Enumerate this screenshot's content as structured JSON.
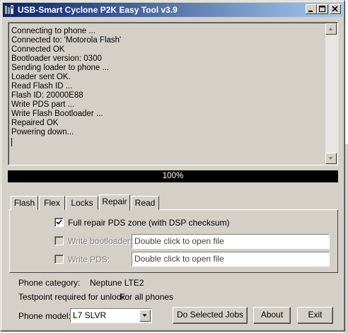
{
  "window": {
    "title": "USB-Smart Cyclone  P2K Easy Tool v3.9",
    "controls": [
      "minimize",
      "maximize",
      "close"
    ]
  },
  "log": {
    "lines": [
      "Connecting to phone ...",
      "Connected to: 'Motorola Flash'",
      "Connected OK",
      "Bootloader version: 0300",
      "Sending loader to phone ...",
      "Loader sent OK.",
      "Read Flash ID ...",
      "Flash ID: 20000E88",
      "Write PDS part ...",
      "Write Flash Bootloader ...",
      "Repaired OK",
      "Powering down..."
    ]
  },
  "progress": {
    "value": 1.0,
    "label": "100%"
  },
  "tabs": [
    {
      "label": "Flash",
      "active": false
    },
    {
      "label": "Flex",
      "active": false
    },
    {
      "label": "Locks",
      "active": false
    },
    {
      "label": "Repair",
      "active": true
    },
    {
      "label": "Read",
      "active": false
    }
  ],
  "repair": {
    "full_repair_label": "Full repair PDS zone (with DSP checksum)",
    "full_repair_checked": true,
    "write_bootloader_label": "Write bootloader:",
    "write_bootloader_checked": false,
    "write_bootloader_placeholder": "Double click to open file",
    "write_pds_label": "Write PDS:",
    "write_pds_checked": false,
    "write_pds_placeholder": "Double click to open file"
  },
  "info": {
    "phone_category_label": "Phone category:",
    "phone_category_value": "Neptune LTE2",
    "testpoint_label": "Testpoint required for unlock:",
    "testpoint_value": "For all phones"
  },
  "phone_model": {
    "label": "Phone model:",
    "selected": "L7 SLVR"
  },
  "buttons": {
    "do_jobs": "Do Selected Jobs",
    "about": "About",
    "exit": "Exit"
  },
  "colors": {
    "titlebar_start": "#0a246a",
    "titlebar_end": "#a6caf0",
    "face": "#d4d0c8",
    "progress_fill": "#000000"
  }
}
